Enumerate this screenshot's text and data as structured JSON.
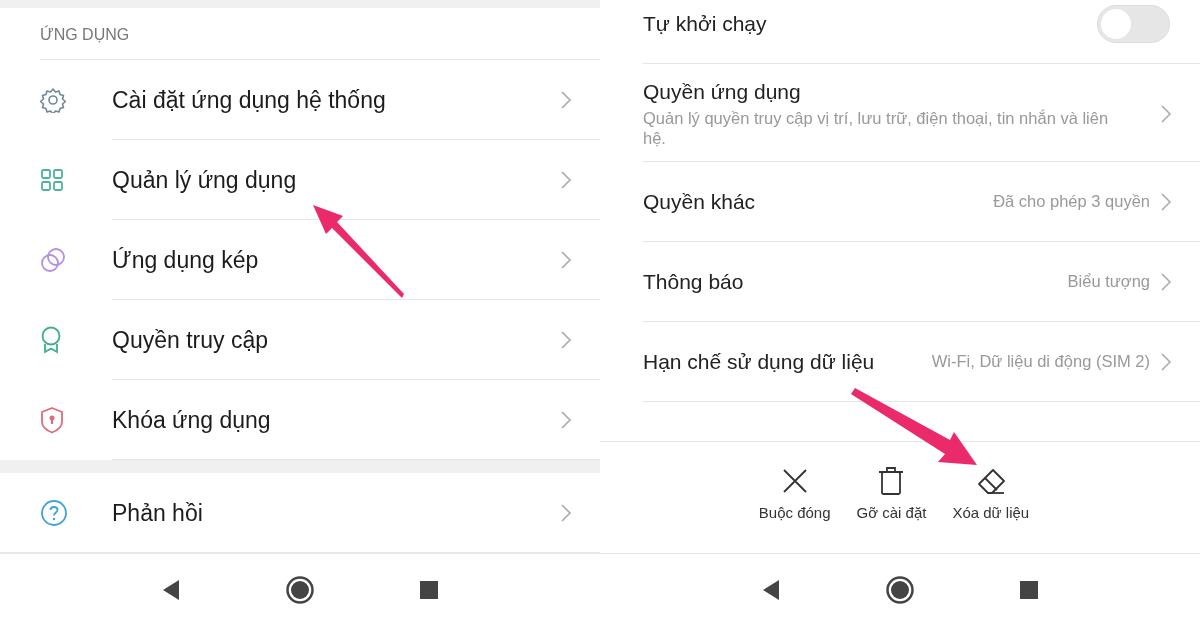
{
  "left_screen": {
    "section_header": "ỨNG DỤNG",
    "items": [
      {
        "label": "Cài đặt ứng dụng hệ thống"
      },
      {
        "label": "Quản lý ứng dụng"
      },
      {
        "label": "Ứng dụng kép"
      },
      {
        "label": "Quyền truy cập"
      },
      {
        "label": "Khóa ứng dụng"
      }
    ],
    "feedback_item": {
      "label": "Phản hồi"
    }
  },
  "right_screen": {
    "settings": [
      {
        "kind": "toggle",
        "label": "Tự khởi chạy",
        "on": false
      },
      {
        "kind": "link",
        "label": "Quyền ứng dụng",
        "description": "Quản lý quyền truy cập vị trí, lưu trữ, điện thoại, tin nhắn và liên hệ."
      },
      {
        "kind": "link",
        "label": "Quyền khác",
        "value": "Đã cho phép 3 quyền"
      },
      {
        "kind": "link",
        "label": "Thông báo",
        "value": "Biểu tượng"
      },
      {
        "kind": "link",
        "label": "Hạn chế sử dụng dữ liệu",
        "value": "Wi-Fi, Dữ liệu di động (SIM 2)"
      }
    ],
    "actions": [
      {
        "label": "Buộc đóng"
      },
      {
        "label": "Gỡ cài đặt"
      },
      {
        "label": "Xóa dữ liệu"
      }
    ]
  }
}
